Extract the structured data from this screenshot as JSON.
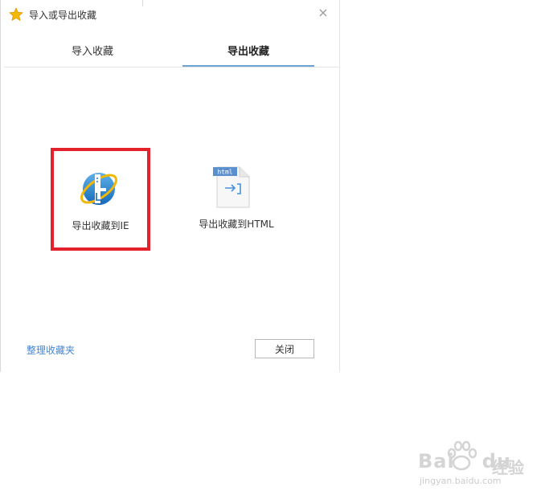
{
  "window": {
    "title": "导入或导出收藏",
    "close_glyph": "×"
  },
  "tabs": [
    {
      "label": "导入收藏",
      "active": false
    },
    {
      "label": "导出收藏",
      "active": true
    }
  ],
  "options": {
    "ie": {
      "label": "导出收藏到IE",
      "icon": "ie-icon",
      "highlighted": true
    },
    "html": {
      "label": "导出收藏到HTML",
      "icon": "html-file-icon",
      "badge": "html"
    }
  },
  "footer": {
    "manage_link": "整理收藏夹",
    "close_button": "关闭"
  },
  "watermark": {
    "brand_latin": "Bai",
    "brand_latin_2": "du",
    "brand_cn": "经验",
    "url": "jingyan.baidu.com"
  },
  "colors": {
    "accent": "#6fa3d6",
    "highlight_box": "#e3212a",
    "link": "#4a86c8",
    "star": "#f5b800"
  }
}
